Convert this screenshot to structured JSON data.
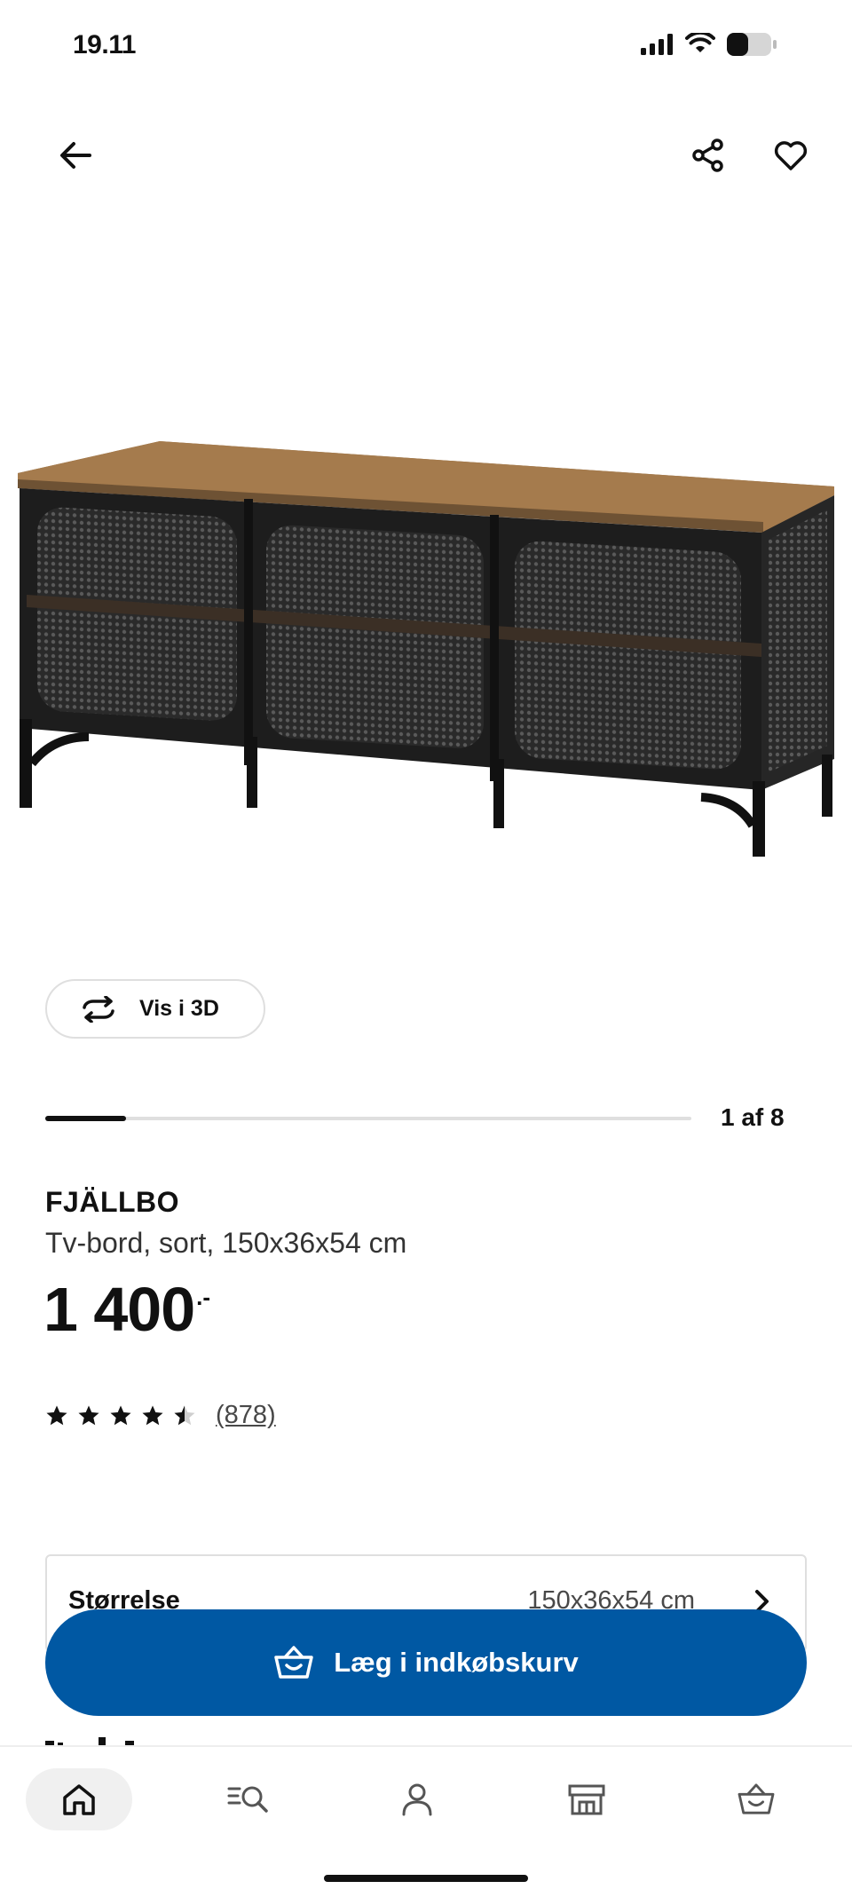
{
  "status_bar": {
    "time": "19.11",
    "icons": [
      "signal-icon",
      "wifi-icon",
      "battery-icon"
    ]
  },
  "top_nav": {
    "icons": [
      "back-arrow-icon",
      "share-icon",
      "heart-icon"
    ]
  },
  "gallery": {
    "view_3d_label": "Vis i 3D",
    "pager_text": "1 af 8",
    "current_image": 1,
    "total_images": 8
  },
  "product": {
    "name": "FJÄLLBO",
    "description": "Tv-bord, sort, 150x36x54 cm",
    "price": "1 400",
    "price_suffix": ".-",
    "rating_value": 4.5,
    "rating_max": 5,
    "review_count": "(878)"
  },
  "size_selector": {
    "label": "Størrelse",
    "value": "150x36x54 cm"
  },
  "add_to_cart": {
    "label": "Læg i indkøbskurv"
  },
  "bottom_nav": {
    "tabs": [
      "home-icon",
      "search-icon",
      "profile-icon",
      "store-icon",
      "cart-icon"
    ],
    "active_tab": "home-icon"
  },
  "colors": {
    "brand_blue": "#0058a3",
    "text": "#111111",
    "muted": "#484848",
    "border": "#dfdfdf"
  }
}
